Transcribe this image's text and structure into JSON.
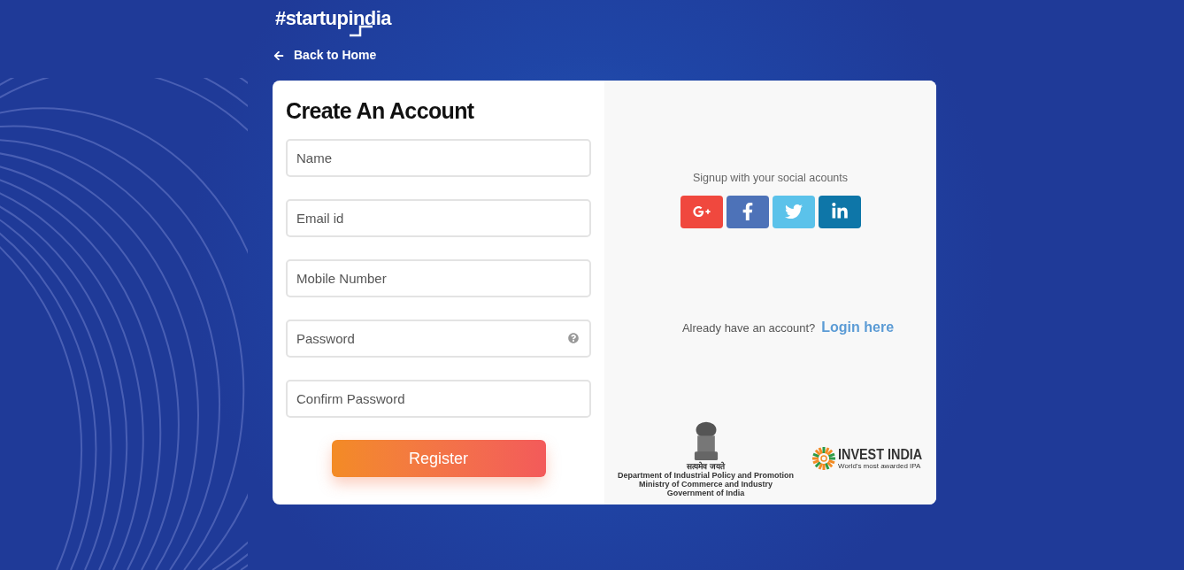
{
  "brand": {
    "logo": "#startupindia"
  },
  "back_link": {
    "label": "Back to Home"
  },
  "form": {
    "title": "Create An Account",
    "fields": [
      {
        "placeholder": "Name",
        "help": false
      },
      {
        "placeholder": "Email id",
        "help": false
      },
      {
        "placeholder": "Mobile Number",
        "help": false
      },
      {
        "placeholder": "Password",
        "help": true
      },
      {
        "placeholder": "Confirm Password",
        "help": false
      }
    ],
    "submit": "Register"
  },
  "social": {
    "heading": "Signup with your social acounts",
    "buttons": [
      {
        "kind": "google"
      },
      {
        "kind": "facebook"
      },
      {
        "kind": "twitter"
      },
      {
        "kind": "linkedin"
      }
    ]
  },
  "login": {
    "prompt": "Already have an account?",
    "link": "Login here"
  },
  "partners": {
    "emblem_caption": [
      "सत्यमेव जयते",
      "Department of Industrial Policy and Promotion",
      "Ministry of Commerce and Industry",
      "Government of India"
    ],
    "invest_india": {
      "name": "INVEST INDIA",
      "tagline": "World's most awarded IPA"
    }
  }
}
